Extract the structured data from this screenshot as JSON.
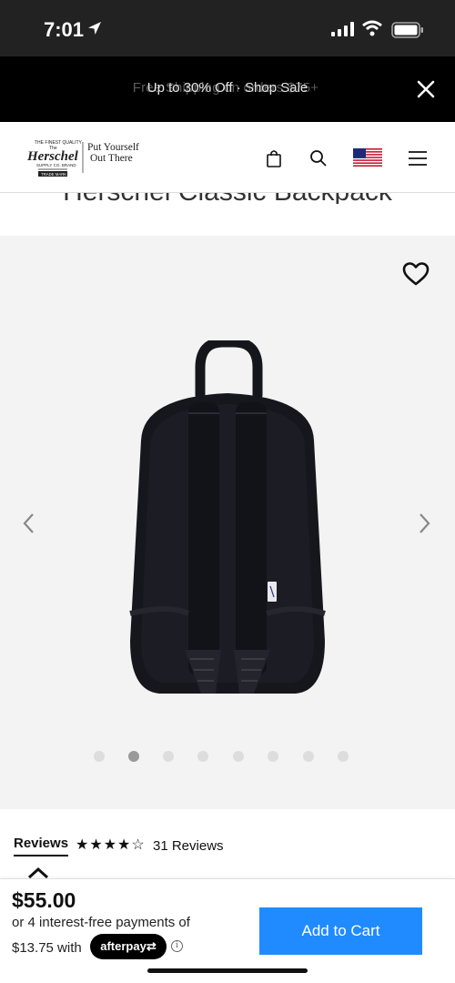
{
  "status_bar": {
    "time": "7:01"
  },
  "promo": {
    "ghost_text": "Free Shipping on orders $75+",
    "message": "Up to 30% Off · Shop Sale"
  },
  "header": {
    "logo_sub_line1": "Put Yourself",
    "logo_sub_line2": "Out There",
    "logo_brand": "Herschel"
  },
  "product": {
    "title": "Herschel Classic Backpack",
    "image_count": 8,
    "active_image_index": 1
  },
  "reviews": {
    "label": "Reviews",
    "rating_stars": "★★★★☆",
    "rating": 4,
    "count_text": "31 Reviews"
  },
  "purchase": {
    "price": "$55.00",
    "installments_line1": "or 4 interest-free payments of",
    "installments_amount": "$13.75 with",
    "afterpay_label": "afterpay⇄",
    "info_glyph": "i",
    "add_to_cart": "Add to Cart"
  },
  "colors": {
    "cta_blue": "#1f8bff",
    "promo_bg": "#000000",
    "gallery_bg": "#f3f3f3"
  },
  "icons": [
    "location-arrow-icon",
    "signal-icon",
    "wifi-icon",
    "battery-icon",
    "close-icon",
    "bag-icon",
    "search-icon",
    "us-flag-icon",
    "menu-icon",
    "heart-icon",
    "chevron-left-icon",
    "chevron-right-icon",
    "chevron-up-icon",
    "info-icon"
  ]
}
